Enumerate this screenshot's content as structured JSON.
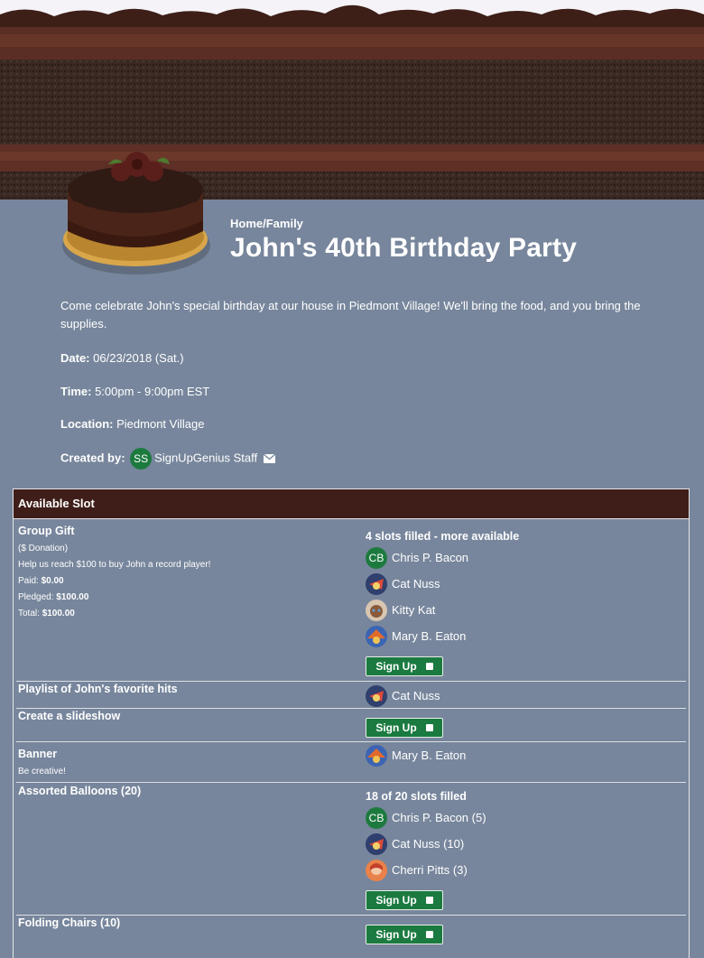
{
  "header": {
    "category": "Home/Family",
    "title": "John's 40th Birthday Party",
    "description": "Come celebrate John's special birthday at our house in Piedmont Village! We'll bring the food, and you bring the supplies."
  },
  "info": {
    "date_label": "Date:",
    "date_value": "06/23/2018 (Sat.)",
    "time_label": "Time:",
    "time_value": "5:00pm - 9:00pm EST",
    "location_label": "Location:",
    "location_value": "Piedmont Village",
    "created_label": "Created by:",
    "creator_initials": "SS",
    "creator_name": "SignUpGenius Staff"
  },
  "table": {
    "header": "Available Slot",
    "signup_label": "Sign Up",
    "rows": [
      {
        "name": "Group Gift",
        "sub1": "($ Donation)",
        "sub2": "Help us reach $100 to buy John a record player!",
        "paid_label": "Paid:",
        "paid_value": "$0.00",
        "pledged_label": "Pledged:",
        "pledged_value": "$100.00",
        "total_label": "Total:",
        "total_value": "$100.00",
        "status": "4 slots filled - more available",
        "people": [
          "Chris P. Bacon",
          "Cat Nuss",
          "Kitty Kat",
          "Mary B. Eaton"
        ],
        "cb_initials": "CB"
      },
      {
        "name": "Playlist of John's favorite hits",
        "people": [
          "Cat Nuss"
        ]
      },
      {
        "name": "Create a slideshow"
      },
      {
        "name": "Banner",
        "sub1": "Be creative!",
        "people": [
          "Mary B. Eaton"
        ]
      },
      {
        "name": "Assorted Balloons (20)",
        "status": "18 of 20 slots filled",
        "people": [
          "Chris P. Bacon (5)",
          "Cat Nuss (10)",
          "Cherri Pitts (3)"
        ],
        "cb_initials": "CB"
      },
      {
        "name": "Folding Chairs (10)"
      }
    ]
  },
  "colors": {
    "page_bg": "#77869c",
    "header_bg": "#3f1e19",
    "button_green": "#1b7a40"
  }
}
